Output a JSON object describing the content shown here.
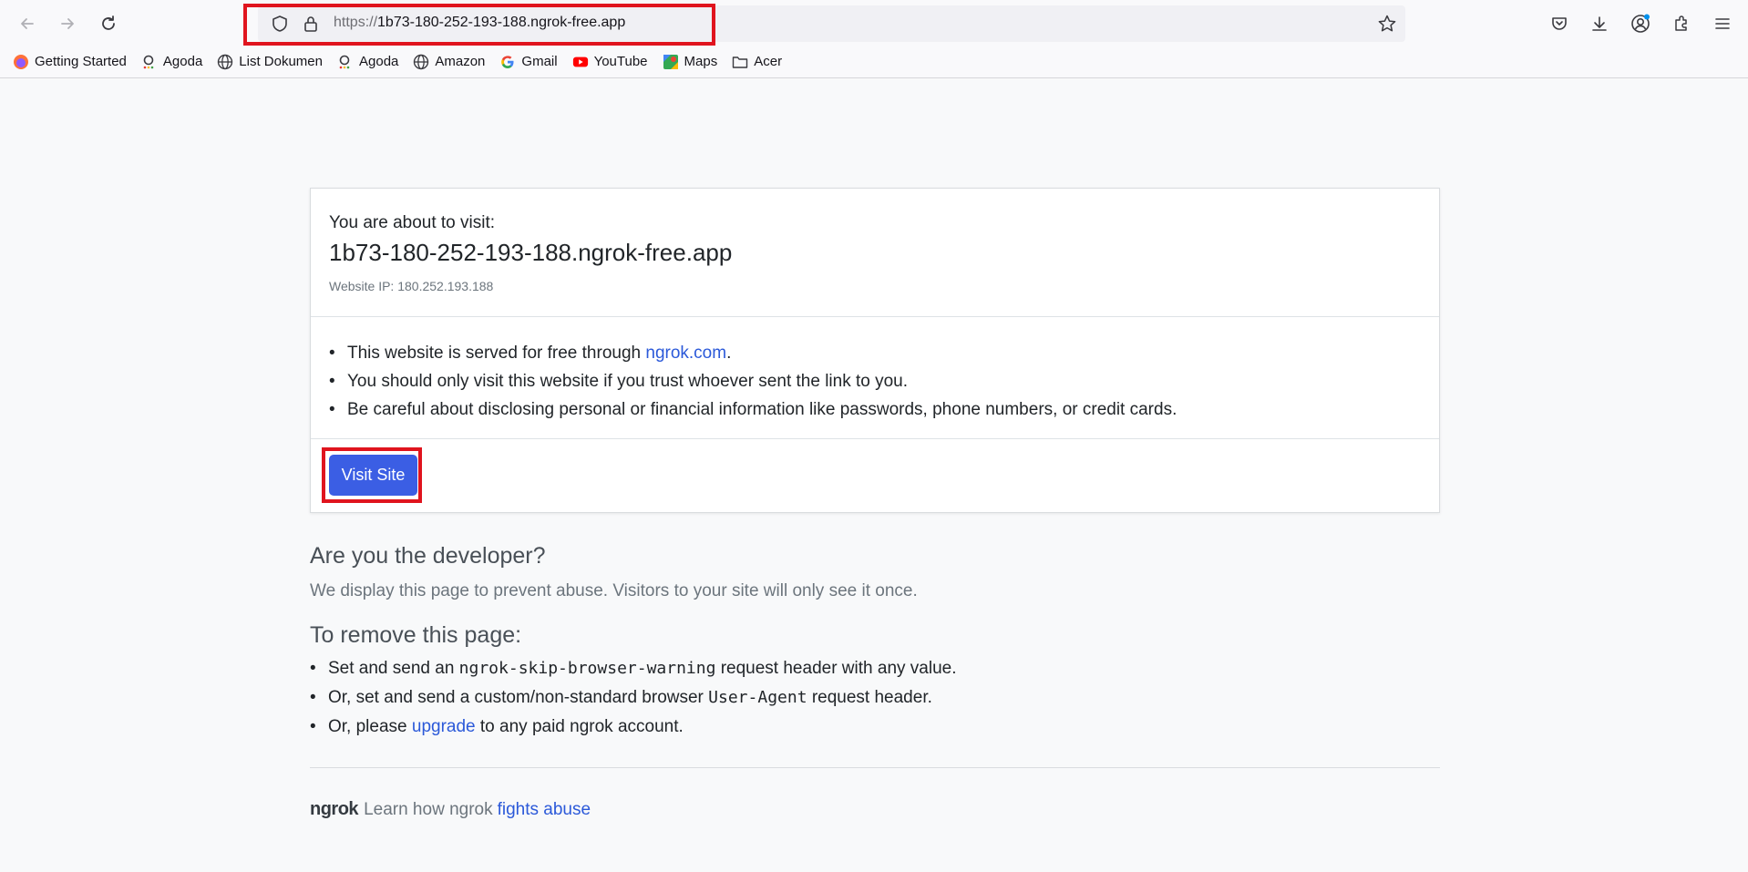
{
  "browser": {
    "url_scheme": "https://",
    "url_host": "1b73-180-252-193-188.ngrok-free.app",
    "icons": {
      "back": "back-arrow-icon",
      "forward": "forward-arrow-icon",
      "reload": "reload-icon",
      "tracking": "shield-icon",
      "lock": "lock-icon",
      "bookmark": "star-icon",
      "pocket": "pocket-icon",
      "downloads": "download-icon",
      "account": "account-icon",
      "extensions": "puzzle-icon",
      "menu": "hamburger-menu-icon"
    },
    "bookmarks": [
      {
        "label": "Getting Started",
        "icon": "firefox-icon"
      },
      {
        "label": "Agoda",
        "icon": "agoda-icon"
      },
      {
        "label": "List Dokumen",
        "icon": "globe-icon"
      },
      {
        "label": "Agoda",
        "icon": "agoda-icon"
      },
      {
        "label": "Amazon",
        "icon": "globe-icon"
      },
      {
        "label": "Gmail",
        "icon": "google-icon"
      },
      {
        "label": "YouTube",
        "icon": "youtube-icon"
      },
      {
        "label": "Maps",
        "icon": "maps-icon"
      },
      {
        "label": "Acer",
        "icon": "folder-icon"
      }
    ]
  },
  "card": {
    "about_label": "You are about to visit:",
    "host": "1b73-180-252-193-188.ngrok-free.app",
    "ip_label": "Website IP: 180.252.193.188",
    "bullet1_prefix": "This website is served for free through ",
    "bullet1_link": "ngrok.com",
    "bullet1_suffix": ".",
    "bullet2": "You should only visit this website if you trust whoever sent the link to you.",
    "bullet3": "Be careful about disclosing personal or financial information like passwords, phone numbers, or credit cards.",
    "visit_button": "Visit Site"
  },
  "developer": {
    "title": "Are you the developer?",
    "description": "We display this page to prevent abuse. Visitors to your site will only see it once.",
    "remove_title": "To remove this page:",
    "item1_prefix": "Set and send an ",
    "item1_code": "ngrok-skip-browser-warning",
    "item1_suffix": " request header with any value.",
    "item2_prefix": "Or, set and send a custom/non-standard browser ",
    "item2_code": "User-Agent",
    "item2_suffix": " request header.",
    "item3_prefix": "Or, please ",
    "item3_link": "upgrade",
    "item3_suffix": " to any paid ngrok account."
  },
  "footer": {
    "logo": "ngrok",
    "text": " Learn how ngrok ",
    "link": "fights abuse"
  },
  "colors": {
    "highlight": "#e0141e",
    "button": "#3b5ee4",
    "link": "#2b59d9"
  }
}
